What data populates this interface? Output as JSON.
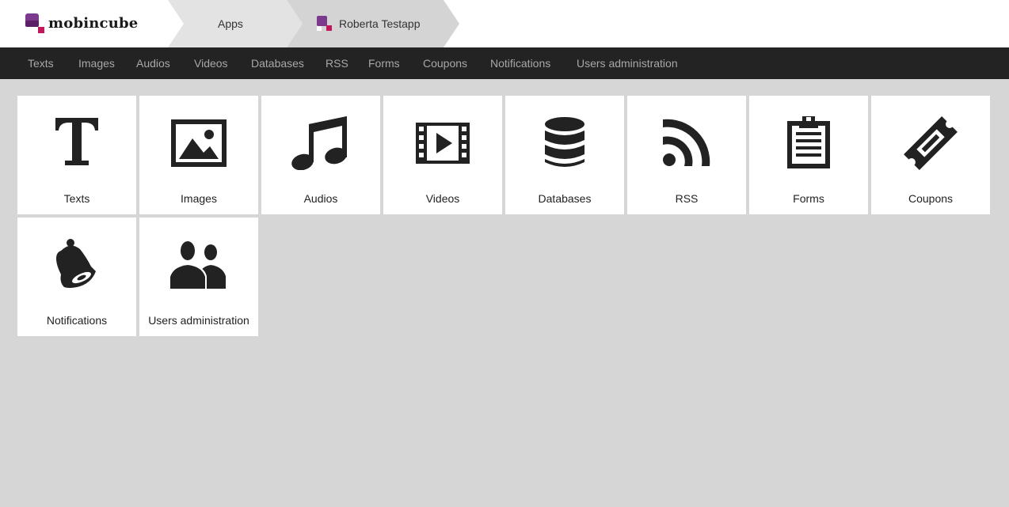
{
  "header": {
    "logo_text": "mobincube",
    "breadcrumbs": [
      {
        "label": "Apps"
      },
      {
        "label": "Roberta Testapp"
      }
    ]
  },
  "nav": {
    "items": [
      {
        "label": "Texts"
      },
      {
        "label": "Images"
      },
      {
        "label": "Audios"
      },
      {
        "label": "Videos"
      },
      {
        "label": "Databases"
      },
      {
        "label": "RSS"
      },
      {
        "label": "Forms"
      },
      {
        "label": "Coupons"
      },
      {
        "label": "Notifications"
      },
      {
        "label": "Users administration"
      }
    ]
  },
  "tiles": [
    {
      "label": "Texts",
      "icon": "text-icon"
    },
    {
      "label": "Images",
      "icon": "image-icon"
    },
    {
      "label": "Audios",
      "icon": "music-icon"
    },
    {
      "label": "Videos",
      "icon": "film-icon"
    },
    {
      "label": "Databases",
      "icon": "database-icon"
    },
    {
      "label": "RSS",
      "icon": "rss-icon"
    },
    {
      "label": "Forms",
      "icon": "clipboard-icon"
    },
    {
      "label": "Coupons",
      "icon": "ticket-icon"
    },
    {
      "label": "Notifications",
      "icon": "bell-icon"
    },
    {
      "label": "Users administration",
      "icon": "users-icon"
    }
  ],
  "colors": {
    "brand_purple": "#6b2a7a",
    "brand_magenta": "#c2185b",
    "navbar_bg": "#232323",
    "nav_text": "#a8a8a8",
    "page_bg": "#d6d6d6",
    "tile_bg": "#ffffff",
    "icon": "#222222"
  }
}
